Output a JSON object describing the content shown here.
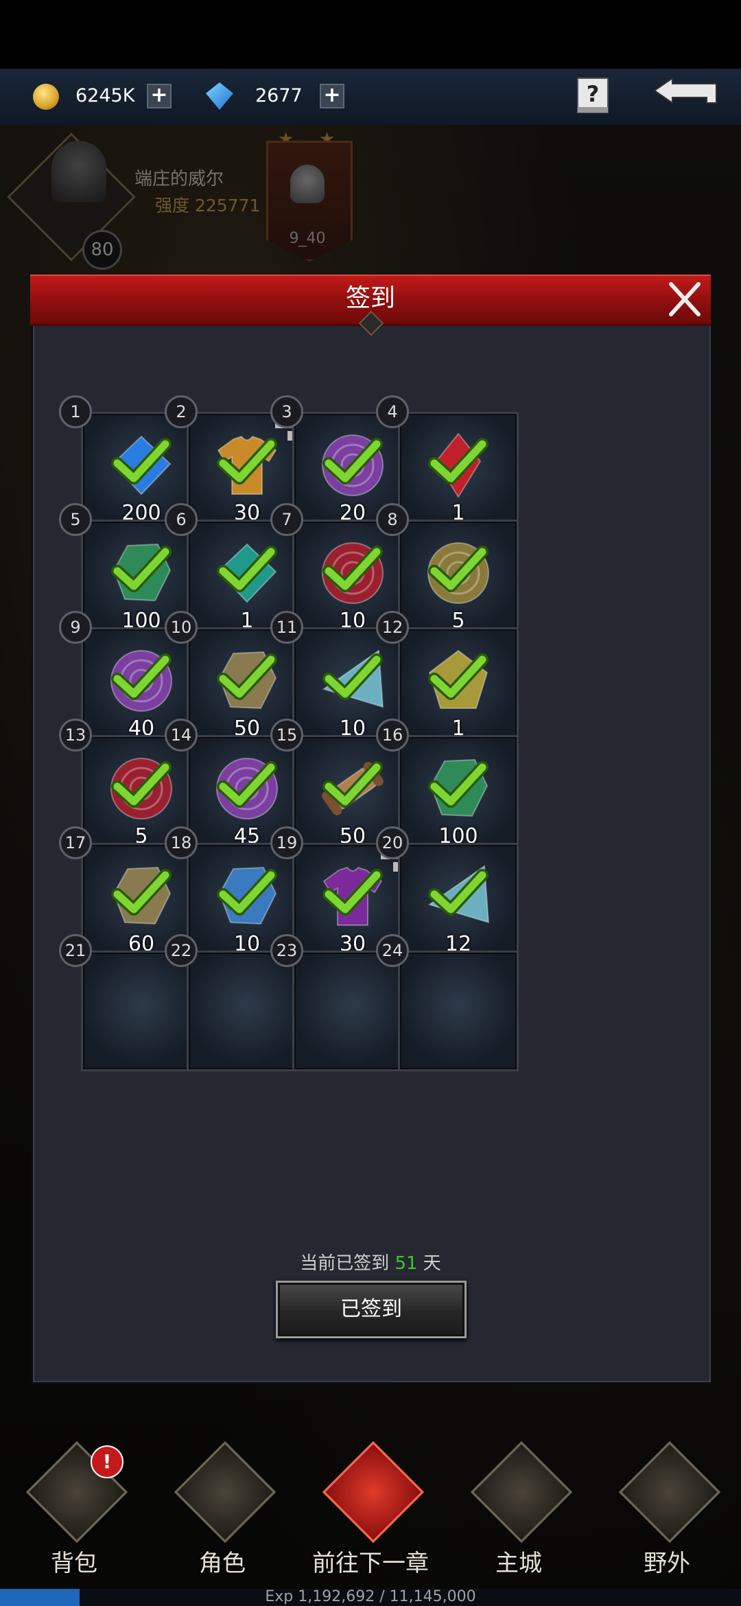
{
  "currency": {
    "gold": "6245K",
    "gems": "2677"
  },
  "player": {
    "name": "端庄的威尔",
    "power_label": "强度 225771",
    "level": "80",
    "banner_label": "9_40"
  },
  "dialog": {
    "title": "签到",
    "signin_prefix": "当前已签到 ",
    "signin_days": "51",
    "signin_suffix": " 天",
    "button_label": "已签到"
  },
  "rewards": [
    {
      "day": "1",
      "qty": "200",
      "icon": "blue-diamond-icon",
      "color": "#2a7de0",
      "shape": "diamond"
    },
    {
      "day": "2",
      "qty": "30",
      "icon": "orange-shirt-icon",
      "color": "#c98a2a",
      "shape": "shirt",
      "badge": true
    },
    {
      "day": "3",
      "qty": "20",
      "icon": "purple-orb-icon",
      "color": "#7a3fa0",
      "shape": "orb"
    },
    {
      "day": "4",
      "qty": "1",
      "icon": "red-gem-icon",
      "color": "#c0202a",
      "shape": "kite"
    },
    {
      "day": "5",
      "qty": "100",
      "icon": "green-crystal-icon",
      "color": "#2f8a5a",
      "shape": "crystal"
    },
    {
      "day": "6",
      "qty": "1",
      "icon": "teal-gem-icon",
      "color": "#1f9a8a",
      "shape": "diamond"
    },
    {
      "day": "7",
      "qty": "10",
      "icon": "red-orb-icon",
      "color": "#9a2030",
      "shape": "orb"
    },
    {
      "day": "8",
      "qty": "5",
      "icon": "gold-orb-icon",
      "color": "#8a7a3a",
      "shape": "orb"
    },
    {
      "day": "9",
      "qty": "40",
      "icon": "purple-orb-icon",
      "color": "#7a3fa0",
      "shape": "orb"
    },
    {
      "day": "10",
      "qty": "50",
      "icon": "tan-crystal-icon",
      "color": "#8a7a50",
      "shape": "crystal"
    },
    {
      "day": "11",
      "qty": "10",
      "icon": "rainbow-gem-icon",
      "color": "#6ab0c0",
      "shape": "tri"
    },
    {
      "day": "12",
      "qty": "1",
      "icon": "yellow-gem-icon",
      "color": "#a89a3a",
      "shape": "penta"
    },
    {
      "day": "13",
      "qty": "5",
      "icon": "red-orb-icon",
      "color": "#9a2030",
      "shape": "orb"
    },
    {
      "day": "14",
      "qty": "45",
      "icon": "purple-orb-icon",
      "color": "#7a3fa0",
      "shape": "orb"
    },
    {
      "day": "15",
      "qty": "50",
      "icon": "scroll-icon",
      "color": "#b08050",
      "shape": "scroll"
    },
    {
      "day": "16",
      "qty": "100",
      "icon": "green-crystal-icon",
      "color": "#2f8a5a",
      "shape": "crystal"
    },
    {
      "day": "17",
      "qty": "60",
      "icon": "tan-crystal-icon",
      "color": "#8a7a50",
      "shape": "crystal"
    },
    {
      "day": "18",
      "qty": "10",
      "icon": "blue-crystal-icon",
      "color": "#3a7ac0",
      "shape": "crystal"
    },
    {
      "day": "19",
      "qty": "30",
      "icon": "purple-shirt-icon",
      "color": "#7a2a9a",
      "shape": "shirt",
      "badge": true
    },
    {
      "day": "20",
      "qty": "12",
      "icon": "rainbow-gem-icon",
      "color": "#6ab0c0",
      "shape": "tri"
    },
    {
      "day": "21",
      "qty": "",
      "icon": "blank-icon",
      "color": "#333",
      "shape": "none"
    },
    {
      "day": "22",
      "qty": "",
      "icon": "blank-icon",
      "color": "#333",
      "shape": "none"
    },
    {
      "day": "23",
      "qty": "",
      "icon": "blank-icon",
      "color": "#333",
      "shape": "none"
    },
    {
      "day": "24",
      "qty": "",
      "icon": "blank-icon",
      "color": "#333",
      "shape": "none"
    }
  ],
  "nav": [
    {
      "label": "背包",
      "icon": "chest-icon"
    },
    {
      "label": "角色",
      "icon": "helmet-icon"
    },
    {
      "label": "前往下一章",
      "icon": "demon-emblem-icon"
    },
    {
      "label": "主城",
      "icon": "castle-icon"
    },
    {
      "label": "野外",
      "icon": "camp-icon"
    }
  ],
  "exp": {
    "text": "Exp  1,192,692 / 11,145,000",
    "fraction": 0.107
  }
}
